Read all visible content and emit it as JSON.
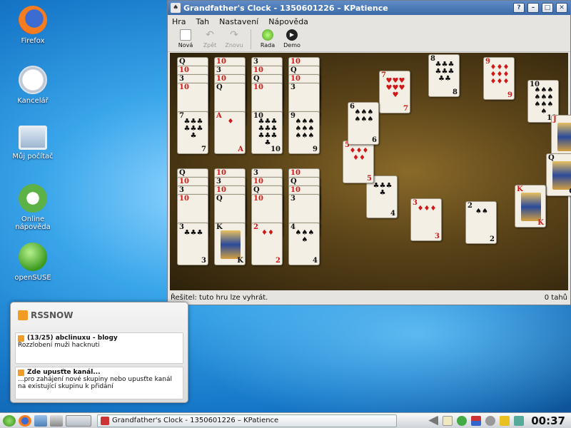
{
  "desktop": {
    "icons": [
      {
        "label": "Firefox"
      },
      {
        "label": "Kancelář"
      },
      {
        "label": "Můj počítač"
      },
      {
        "label": "Online nápověda"
      },
      {
        "label": "openSUSE"
      }
    ]
  },
  "window": {
    "title": "Grandfather's Clock - 1350601226 – KPatience",
    "menu": [
      "Hra",
      "Tah",
      "Nastavení",
      "Nápověda"
    ],
    "toolbar": [
      {
        "label": "Nová",
        "icon": "new-game-icon",
        "enabled": true
      },
      {
        "label": "Zpět",
        "icon": "undo-icon",
        "enabled": false
      },
      {
        "label": "Znovu",
        "icon": "redo-icon",
        "enabled": false
      },
      {
        "label": "Rada",
        "icon": "hint-bulb-icon",
        "enabled": true
      },
      {
        "label": "Demo",
        "icon": "play-icon",
        "enabled": true
      }
    ],
    "status_left": "Řešitel: tuto hru lze vyhrát.",
    "status_right": "0 tahů"
  },
  "cards": {
    "tableau_col1_bottom": {
      "rank": "7",
      "suit": "♣"
    },
    "tableau_col2_bottom": {
      "rank": "A",
      "suit": "♦"
    },
    "tableau_col3_bottom": {
      "rank": "10",
      "suit": "♣"
    },
    "tableau_col4_bottom": {
      "rank": "9",
      "suit": "♠"
    },
    "tableau_col5_bottom": {
      "rank": "3",
      "suit": "♣"
    },
    "tableau_col6_bottom": {
      "rank": "K",
      "suit": "♣"
    },
    "tableau_col7_bottom": {
      "rank": "2",
      "suit": "♦"
    },
    "tableau_col8_bottom": {
      "rank": "4",
      "suit": "♠"
    },
    "clock": [
      {
        "rank": "7",
        "suit": "♥"
      },
      {
        "rank": "8",
        "suit": "♣"
      },
      {
        "rank": "9",
        "suit": "♦"
      },
      {
        "rank": "10",
        "suit": "♠"
      },
      {
        "rank": "J",
        "suit": "♥"
      },
      {
        "rank": "Q",
        "suit": "♣"
      },
      {
        "rank": "K",
        "suit": "♦"
      },
      {
        "rank": "2",
        "suit": "♠"
      },
      {
        "rank": "3",
        "suit": "♦"
      },
      {
        "rank": "4",
        "suit": "♣"
      },
      {
        "rank": "5",
        "suit": "♦"
      },
      {
        "rank": "6",
        "suit": "♠"
      }
    ]
  },
  "rss": {
    "brand": "RSSNOW",
    "items": [
      {
        "title": "(13/25) abclinuxu - blogy",
        "text": "Rozzlobení muži hacknuti"
      },
      {
        "title": "Zde upusťte kanál...",
        "text": "...pro zahájení nové skupiny nebo upusťte kanál na existující skupinu k přidání"
      }
    ]
  },
  "taskbar": {
    "task_title": "Grandfather's Clock - 1350601226 – KPatience",
    "clock": "00:37"
  }
}
